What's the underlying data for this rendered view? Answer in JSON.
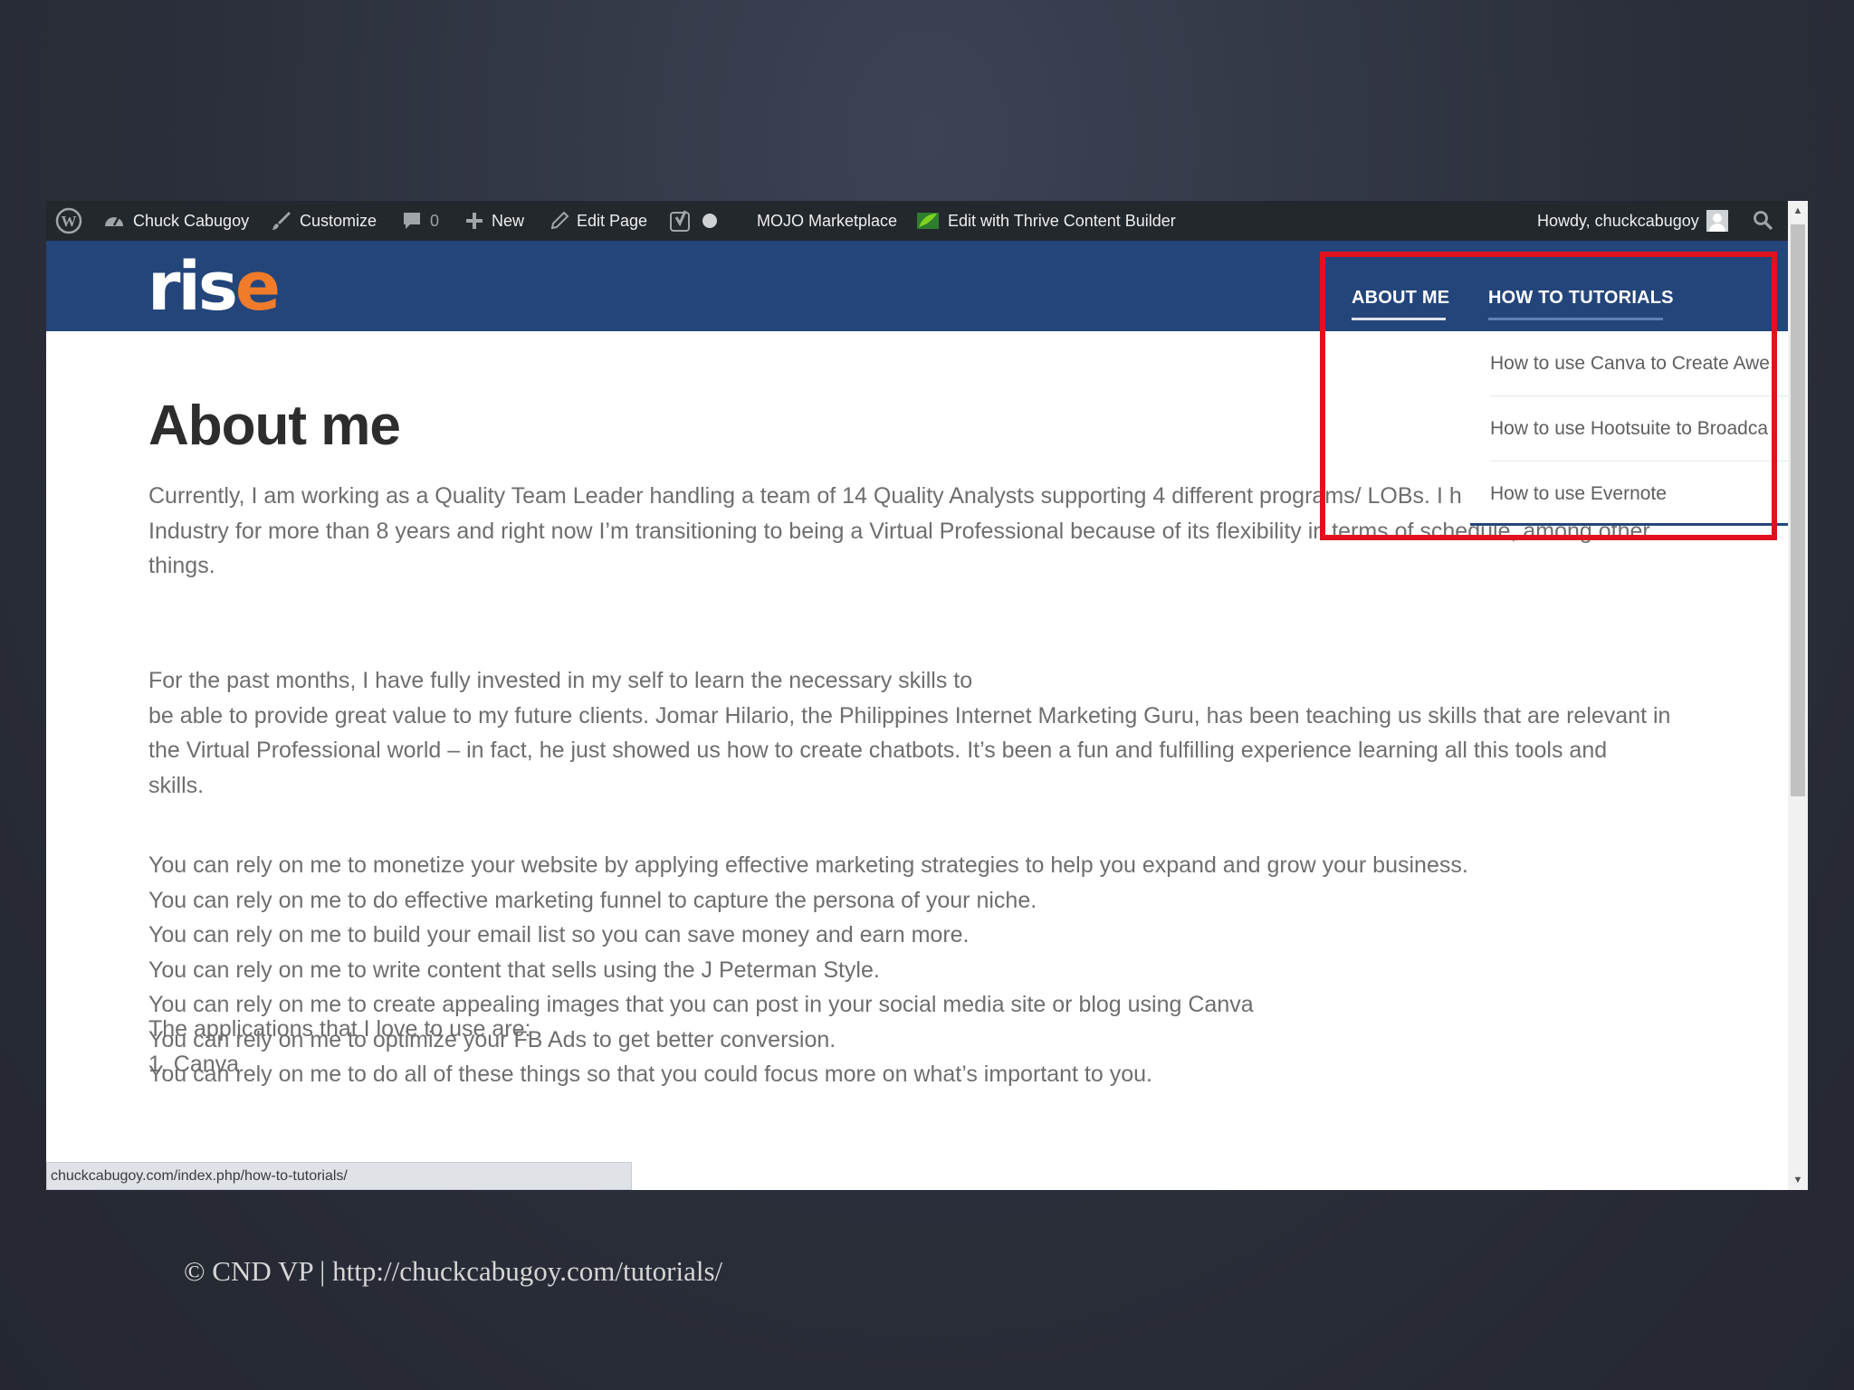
{
  "admin_bar": {
    "site_name": "Chuck Cabugoy",
    "customize": "Customize",
    "comments_count": "0",
    "new": "New",
    "edit_page": "Edit Page",
    "mojo": "MOJO Marketplace",
    "thrive": "Edit with Thrive Content Builder",
    "howdy": "Howdy, chuckcabugoy"
  },
  "header": {
    "logo_main": "ris",
    "logo_accent": "e",
    "nav": [
      "ABOUT ME",
      "HOW TO TUTORIALS"
    ]
  },
  "dropdown": {
    "items": [
      "How to use Canva to Create Awe",
      "How to use Hootsuite to Broadca",
      "How to use Evernote"
    ]
  },
  "page": {
    "title": "About me",
    "p1": [
      "Currently, I am working as a Quality Team Leader handling a team of 14 Quality Analysts supporting 4 different programs/ LOBs. I h",
      "Industry for more than 8 years and right now I’m transitioning to being a Virtual Professional because of its flexibility in terms of schedule, among other",
      "things."
    ],
    "p2": [
      "For the past months, I have fully invested in my self to learn the necessary skills to",
      "be able to provide great value to my future clients. Jomar Hilario, the Philippines Internet Marketing Guru, has been teaching us skills that are relevant in",
      "the Virtual Professional world – in fact, he just showed us how to create chatbots. It’s been a fun and fulfilling experience learning all this tools and",
      "skills."
    ],
    "p3": [
      "You can rely on me to monetize your website by applying effective marketing strategies to help you expand and grow your business.",
      "You can rely on me to do effective marketing funnel to capture the persona of your niche.",
      "You can rely on me to build your email list so you can save money and earn more.",
      "You can rely on me to write content that sells using the J Peterman Style.",
      "You can rely on me to create appealing images that you can post in your social media site or blog using Canva",
      "You can rely on me to optimize your FB Ads to get better conversion.",
      "You can rely on me to do all of these things so that you could focus more on what’s important to you."
    ],
    "p4": [
      "The applications that I love to use are:",
      "1. Canva"
    ]
  },
  "status_url": "chuckcabugoy.com/index.php/how-to-tutorials/",
  "footer": "© CND VP | http://chuckcabugoy.com/tutorials/",
  "colors": {
    "header_blue": "#24457a",
    "admin_bar": "#23282d",
    "highlight_red": "#e0121d",
    "logo_orange": "#f07b2a"
  }
}
